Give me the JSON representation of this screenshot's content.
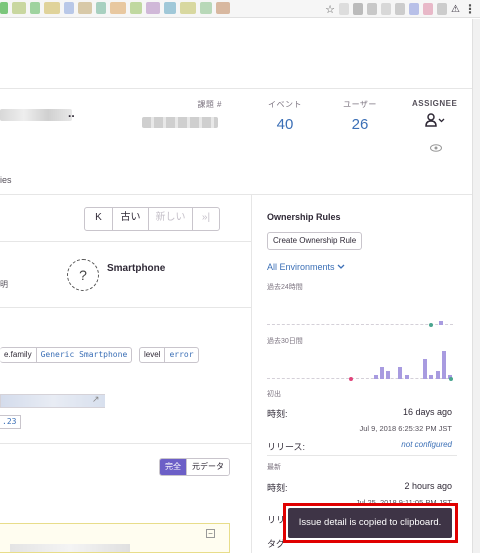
{
  "browser": {
    "star_icon": "star-icon",
    "menu_icon": "kebab-icon"
  },
  "issue": {
    "title_suffix": "..",
    "stats": {
      "issue_id_label": "課題 #",
      "events_label": "イベント",
      "events_value": "40",
      "users_label": "ユーザー",
      "users_value": "26",
      "assignee_label": "ASSIGNEE"
    },
    "tab_partial": "ies"
  },
  "pager": {
    "first": "K",
    "older": "古い",
    "newer": "新しい",
    "last": "»|"
  },
  "device": {
    "name": "Smartphone",
    "partial_label": "明"
  },
  "tags": [
    {
      "key": "e.family",
      "value": "Generic Smartphone"
    },
    {
      "key": "level",
      "value": "error"
    }
  ],
  "release": {
    "version_partial": ".23"
  },
  "stacktrace_toggle": {
    "full": "完全",
    "raw": "元データ"
  },
  "sidebar": {
    "ownership_heading": "Ownership Rules",
    "create_ownership_button": "Create Ownership Rule",
    "environment": "All Environments",
    "last_24h": "過去24時間",
    "last_30d": "過去30日間",
    "first_seen_heading": "初出",
    "time_label": "時刻:",
    "first_seen_rel": "16 days ago",
    "first_seen_abs": "Jul 9, 2018 6:25:32 PM JST",
    "release_label": "リリース:",
    "release_value": "not configured",
    "last_seen_heading": "最新",
    "last_seen_rel": "2 hours ago",
    "last_seen_abs": "Jul 25, 2018 9:11:05 PM JST",
    "release_label_partial": "リリ",
    "tags_label_partial": "タグ"
  },
  "chart_data": [
    {
      "type": "bar",
      "title": "過去24時間",
      "values": [
        0,
        0,
        0,
        0,
        0,
        0,
        0,
        0,
        0,
        0,
        0,
        0,
        0,
        0,
        0,
        0,
        0,
        0,
        0,
        0,
        0,
        0,
        1,
        0
      ]
    },
    {
      "type": "bar",
      "title": "過去30日間",
      "values": [
        0,
        0,
        0,
        0,
        0,
        0,
        0,
        0,
        0,
        0,
        0,
        0,
        0,
        0,
        0,
        0,
        0,
        1,
        3,
        2,
        0,
        3,
        1,
        0,
        0,
        5,
        1,
        2,
        7,
        1
      ]
    }
  ],
  "toast": {
    "message": "Issue detail is copied to clipboard."
  },
  "colors": {
    "accent": "#6c5fc7",
    "link": "#3b6fb6",
    "toast_bg": "#3e3446",
    "highlight_outline": "#e00000"
  }
}
